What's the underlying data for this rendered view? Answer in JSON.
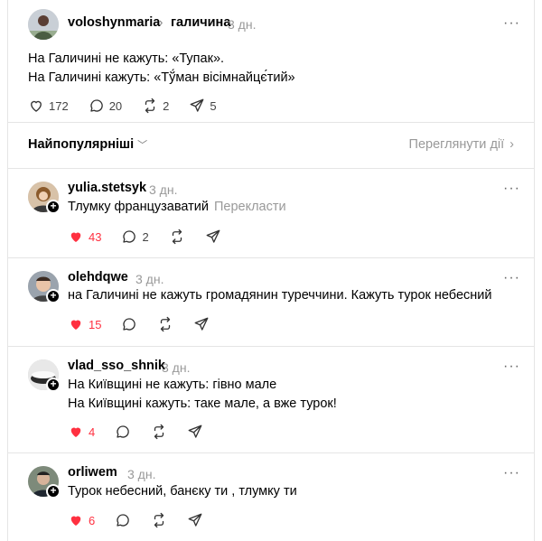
{
  "main_post": {
    "username": "voloshynmaria",
    "topic": "галичина",
    "time": "3 дн.",
    "more": "···",
    "lines": [
      "На Галичині не кажуть: «Тупак».",
      "На Галичині кажуть: «Тў́ман вісімнайцє́тий»"
    ],
    "likes": "172",
    "comments": "20",
    "reposts": "2",
    "shares": "5"
  },
  "sort": {
    "label": "Найпопулярніші",
    "activity": "Переглянути дії"
  },
  "replies": [
    {
      "username": "yulia.stetsyk",
      "time": "3 дн.",
      "lines": [
        "Тлумку французаватий"
      ],
      "translate": "Перекласти",
      "likes": "43",
      "comments": "2",
      "reposts": "",
      "shares": ""
    },
    {
      "username": "olehdqwe",
      "time": "3 дн.",
      "lines": [
        "на Галичині не кажуть громадянин туреччини. Кажуть турок небесний"
      ],
      "likes": "15",
      "comments": "",
      "reposts": "",
      "shares": ""
    },
    {
      "username": "vlad_sso_shnik",
      "time": "3 дн.",
      "lines": [
        "На Київщині не кажуть: гівно мале",
        "На Київщині кажуть: таке мале, а вже турок!"
      ],
      "likes": "4",
      "comments": "",
      "reposts": "",
      "shares": ""
    },
    {
      "username": "orliwem",
      "time": "3 дн.",
      "lines": [
        "Турок небесний, банєку ти , тлумку ти"
      ],
      "likes": "6",
      "comments": "",
      "reposts": "",
      "shares": ""
    }
  ],
  "colors": {
    "like": "#ff3040",
    "muted": "#999999",
    "divider": "#e5e5e5"
  },
  "icons": {
    "like": "heart-icon",
    "comment": "comment-icon",
    "repost": "repost-icon",
    "share": "share-icon",
    "topic": "chevron-right-icon"
  }
}
